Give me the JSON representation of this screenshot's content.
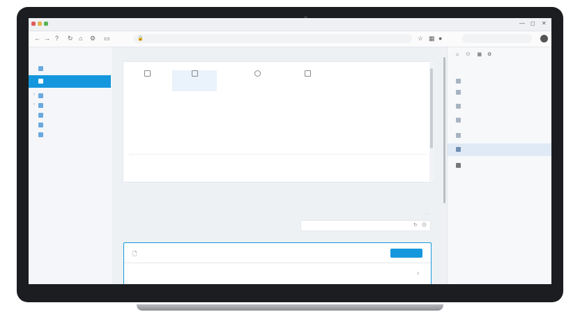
{
  "titlebar": {
    "tab_title": "",
    "menus": [
      "",
      "",
      "",
      "",
      ""
    ],
    "center_text": ""
  },
  "navbar": {
    "url": "",
    "search": ""
  },
  "sidebar": {
    "title": "",
    "items": [
      {
        "label": ""
      },
      {
        "label": ""
      },
      {
        "label": ""
      },
      {
        "label": ""
      },
      {
        "label": ""
      },
      {
        "label": ""
      },
      {
        "label": ""
      }
    ]
  },
  "main": {
    "breadcrumb": [
      "",
      ""
    ],
    "tools": [
      {
        "label": ""
      },
      {
        "label": ""
      },
      {
        "label": ""
      },
      {
        "label": ""
      }
    ],
    "tool_link": "",
    "section_title": "",
    "row1": {
      "label": "",
      "cols": [
        "",
        "",
        "",
        ""
      ]
    },
    "row1_desc": "",
    "row1_desc2": "",
    "row2": {
      "label": "",
      "cols": [
        "",
        "",
        ""
      ]
    },
    "row2_desc": "",
    "section2_title": "",
    "section2_desc": "",
    "field_placeholder": "",
    "card": {
      "title": "",
      "button": "",
      "subtitle": "",
      "link": ""
    }
  },
  "right": {
    "section": "",
    "items": [
      {
        "label": ""
      },
      {
        "label": ""
      },
      {
        "label": ""
      },
      {
        "label": ""
      },
      {
        "label": ""
      },
      {
        "label": ""
      },
      {
        "label": ""
      }
    ]
  },
  "colors": {
    "accent": "#1597dd",
    "laptop_frame": "#1c1d20",
    "screen_bg": "#f4f6f9"
  }
}
